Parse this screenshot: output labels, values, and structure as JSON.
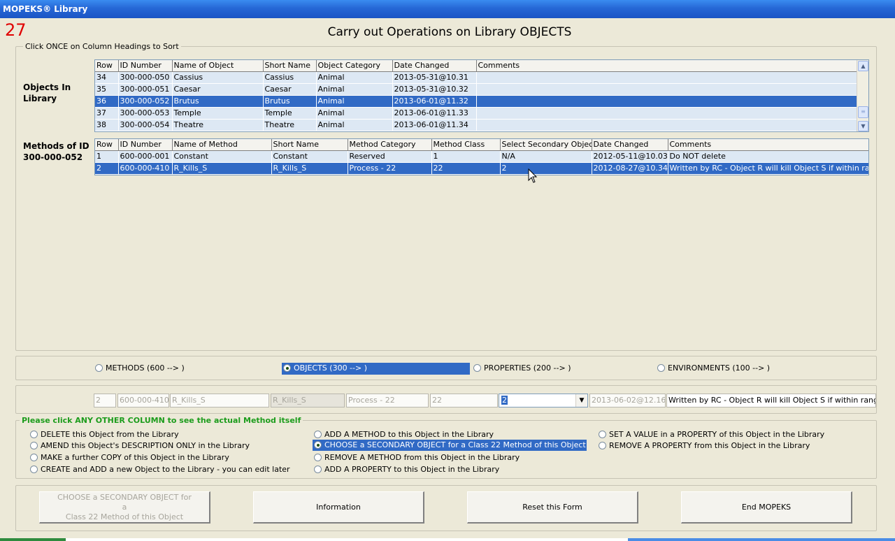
{
  "window": {
    "title": "MOPEKS® Library"
  },
  "counter": "27",
  "heading": "Carry out Operations on Library OBJECTS",
  "sort_legend": "Click ONCE on Column Headings to Sort",
  "objects_label": [
    "Objects In",
    "Library"
  ],
  "methods_label": [
    "Methods of ID",
    "300-000-052"
  ],
  "objects_table": {
    "columns": [
      "Row",
      "ID Number",
      "Name of Object",
      "Short Name",
      "Object Category",
      "Date Changed",
      "Comments"
    ],
    "rows": [
      [
        "34",
        "300-000-050",
        "Cassius",
        "Cassius",
        "Animal",
        "2013-05-31@10.31",
        ""
      ],
      [
        "35",
        "300-000-051",
        "Caesar",
        "Caesar",
        "Animal",
        "2013-05-31@10.32",
        ""
      ],
      [
        "36",
        "300-000-052",
        "Brutus",
        "Brutus",
        "Animal",
        "2013-06-01@11.32",
        ""
      ],
      [
        "37",
        "300-000-053",
        "Temple",
        "Temple",
        "Animal",
        "2013-06-01@11.33",
        ""
      ],
      [
        "38",
        "300-000-054",
        "Theatre",
        "Theatre",
        "Animal",
        "2013-06-01@11.34",
        ""
      ]
    ],
    "selected_row": 2
  },
  "methods_table": {
    "columns": [
      "Row",
      "ID Number",
      "Name of Method",
      "Short Name",
      "Method Category",
      "Method Class",
      "Select Secondary Object",
      "Date Changed",
      "Comments"
    ],
    "rows": [
      [
        "1",
        "600-000-001",
        "Constant",
        "Constant",
        "Reserved",
        "1",
        "N/A",
        "2012-05-11@10.03",
        "Do NOT delete"
      ],
      [
        "2",
        "600-000-410",
        "R_Kills_S",
        "R_Kills_S",
        "Process - 22",
        "22",
        "2",
        "2012-08-27@10.34",
        "Written by RC - Object R will kill Object S if within range"
      ]
    ],
    "selected_row": 1
  },
  "type_radios": {
    "methods": "METHODS (600 --> )",
    "objects": "OBJECTS (300 --> )",
    "properties": "PROPERTIES (200 --> )",
    "environments": "ENVIRONMENTS (100 --> )",
    "selected": "objects"
  },
  "edit_row": {
    "row": "2",
    "id": "600-000-410",
    "name": "R_Kills_S",
    "short": "R_Kills_S",
    "category": "Process - 22",
    "class": "22",
    "secondary": "2",
    "date": "2013-06-02@12.16",
    "comments": "Written by RC - Object R will kill Object S if within range"
  },
  "ops_legend": "Please click ANY OTHER COLUMN to see the actual Method itself",
  "operations": {
    "col1": [
      "DELETE this Object from the Library",
      "AMEND this Object's DESCRIPTION ONLY in the Library",
      "MAKE a further COPY of this Object in the Library",
      "CREATE and ADD a new Object to the Library - you can edit later"
    ],
    "col2": [
      "ADD A METHOD to this Object in the Library",
      "CHOOSE a SECONDARY OBJECT for a Class 22 Method of this Object",
      "REMOVE A METHOD from this Object in the Library",
      "ADD A PROPERTY to this Object in the Library"
    ],
    "col3": [
      "SET A VALUE in a PROPERTY of this Object in the Library",
      "REMOVE A PROPERTY from this Object in the Library"
    ]
  },
  "buttons": {
    "action": [
      "CHOOSE a SECONDARY OBJECT for a",
      "Class 22 Method of this Object"
    ],
    "info": "Information",
    "reset": "Reset this Form",
    "end": "End MOPEKS"
  },
  "colors": {
    "selection": "#316AC5",
    "counter": "#E00000",
    "legend_green": "#1C9C1C",
    "titlebar": "#2667D6"
  }
}
